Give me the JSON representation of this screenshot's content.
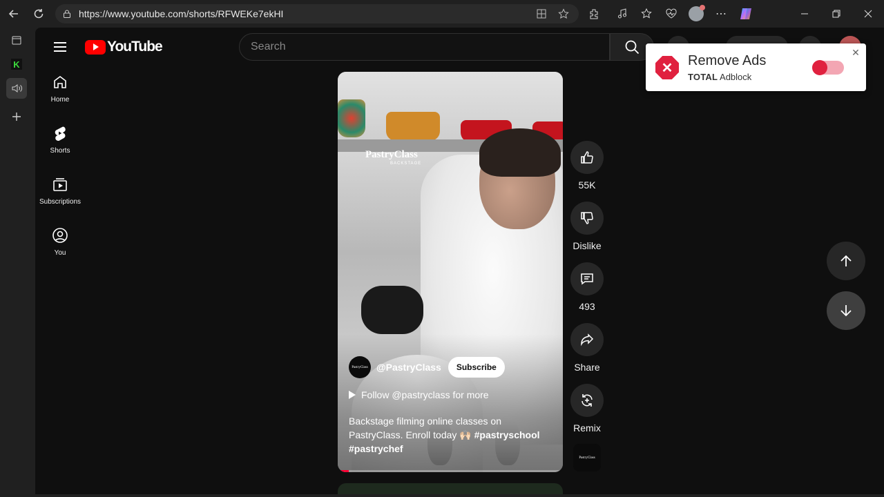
{
  "browser": {
    "url": "https://www.youtube.com/shorts/RFWEKe7ekHI",
    "icons": [
      "back-icon",
      "refresh-icon",
      "site-info-icon",
      "reader-mode-icon",
      "favorite-star-icon",
      "extensions-icon",
      "media-control-icon",
      "favorites-icon",
      "browser-essentials-icon",
      "profile-avatar",
      "more-icon",
      "copilot-icon"
    ]
  },
  "vertical_tabs": [
    "tab-actions-icon",
    "kiwi-tab-icon",
    "audio-tab-icon",
    "new-tab-icon"
  ],
  "youtube": {
    "logo_text": "YouTube",
    "search_placeholder": "Search",
    "sidebar": [
      {
        "label": "Home",
        "icon": "home-icon"
      },
      {
        "label": "Shorts",
        "icon": "shorts-icon"
      },
      {
        "label": "Subscriptions",
        "icon": "subscriptions-icon"
      },
      {
        "label": "You",
        "icon": "you-icon"
      }
    ]
  },
  "short": {
    "watermark": "PastryClass",
    "watermark_sub": "BACKSTAGE",
    "channel_handle": "@PastryClass",
    "channel_avatar_text": "PastryClass",
    "subscribe_label": "Subscribe",
    "follow_text": "Follow @pastryclass for more",
    "caption_text": "Backstage filming online classes on PastryClass. Enroll today 🙌🏻",
    "hashtag_1": "#pastryschool",
    "hashtag_2": "#pastrychef",
    "progress": 0.05
  },
  "actions": {
    "like_count": "55K",
    "dislike_label": "Dislike",
    "comment_count": "493",
    "share_label": "Share",
    "remix_label": "Remix",
    "sound_thumb_text": "PastryClass"
  },
  "adblock_popup": {
    "title": "Remove Ads",
    "brand_bold": "TOTAL",
    "brand_rest": "Adblock",
    "toggle_on": false,
    "accent": "#e0213f"
  },
  "colors": {
    "page_bg": "#0f0f0f",
    "youtube_red": "#ff0000",
    "chrome_bg": "#202020"
  }
}
